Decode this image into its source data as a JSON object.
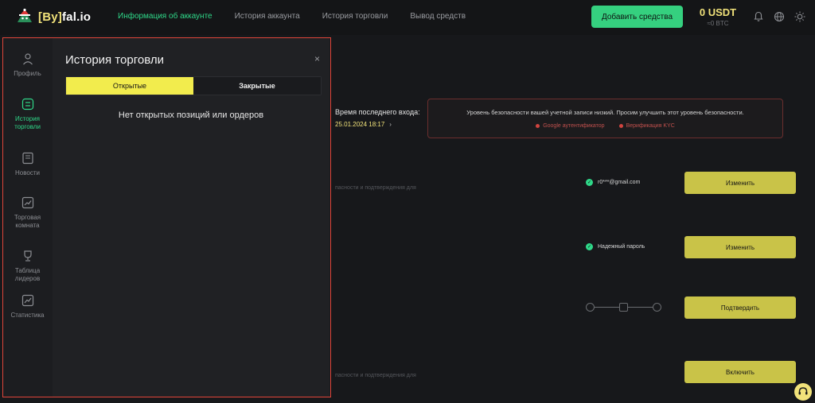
{
  "brand": {
    "name_bracket": "[By]",
    "name_rest": "fal.io"
  },
  "nav": {
    "items": [
      {
        "label": "Информация об аккаунте",
        "active": true
      },
      {
        "label": "История аккаунта",
        "active": false
      },
      {
        "label": "История торговли",
        "active": false
      },
      {
        "label": "Вывод средств",
        "active": false
      }
    ]
  },
  "header": {
    "add_funds_label": "Добавить средства",
    "balance_main": "0 USDT",
    "balance_sub": "≈0 BTC",
    "icons": [
      "bell-icon",
      "globe-icon",
      "sun-icon"
    ]
  },
  "sidebar": {
    "items": [
      {
        "label": "Профиль",
        "icon": "user-icon",
        "active": false
      },
      {
        "label": "История торговли",
        "icon": "history-icon",
        "active": true
      },
      {
        "label": "Новости",
        "icon": "news-icon",
        "active": false
      },
      {
        "label": "Торговая комната",
        "icon": "chart-icon",
        "active": false
      },
      {
        "label": "Таблица лидеров",
        "icon": "trophy-icon",
        "active": false
      },
      {
        "label": "Статистика",
        "icon": "stats-icon",
        "active": false
      }
    ]
  },
  "panel": {
    "title": "История торговли",
    "close_glyph": "×",
    "tabs": [
      {
        "label": "Открытые",
        "active": true
      },
      {
        "label": "Закрытые",
        "active": false
      }
    ],
    "empty_message": "Нет открытых позиций или ордеров"
  },
  "account": {
    "last_login_label": "Время последнего входа:",
    "last_login_value": "25.01.2024 18:17",
    "security_message": "Уровень безопасности вашей учетной записи низкий. Просим улучшить этот уровень безопасности.",
    "security_links": [
      "Google аутентификатор",
      "Верификация KYC"
    ],
    "rows": [
      {
        "faint": "пасности и подтверждения для",
        "status": "r0***@gmail.com",
        "button": "Изменить"
      },
      {
        "faint": "",
        "status": "Надежный пароль",
        "button": "Изменить"
      },
      {
        "faint": "",
        "status": "",
        "button": "Подтвердить"
      },
      {
        "faint": "пасности и подтверждения для",
        "status": "",
        "button": "Включить"
      }
    ]
  },
  "colors": {
    "accent_green": "#2fd889",
    "accent_yellow": "#f2ec4d",
    "button_olive": "#c9c348",
    "warning_red": "#d0443f"
  }
}
